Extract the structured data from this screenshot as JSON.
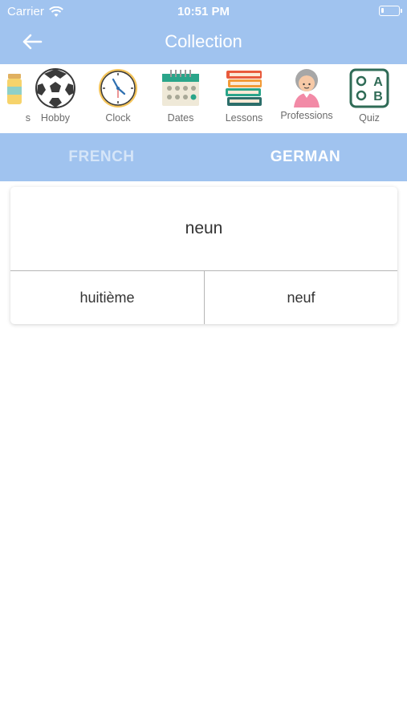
{
  "status_bar": {
    "carrier": "Carrier",
    "time": "10:51 PM",
    "battery_level": 0.15
  },
  "nav": {
    "title": "Collection",
    "back_icon": "arrow-left-icon"
  },
  "categories": [
    {
      "label": "s",
      "icon": "jars-icon"
    },
    {
      "label": "Hobby",
      "icon": "soccer-ball-icon"
    },
    {
      "label": "Clock",
      "icon": "clock-icon"
    },
    {
      "label": "Dates",
      "icon": "calendar-icon"
    },
    {
      "label": "Lessons",
      "icon": "books-icon"
    },
    {
      "label": "Professions",
      "icon": "grandmother-icon"
    },
    {
      "label": "Quiz",
      "icon": "quiz-abc-icon"
    }
  ],
  "tabs": {
    "french": "FRENCH",
    "german": "GERMAN",
    "selected": "GERMAN"
  },
  "quiz": {
    "question": "neun",
    "answers": [
      "huitième",
      "neuf"
    ]
  },
  "colors": {
    "header_bg": "#a0c3ef",
    "tab_inactive": "#d5e5f8",
    "tab_active": "#ffffff"
  }
}
